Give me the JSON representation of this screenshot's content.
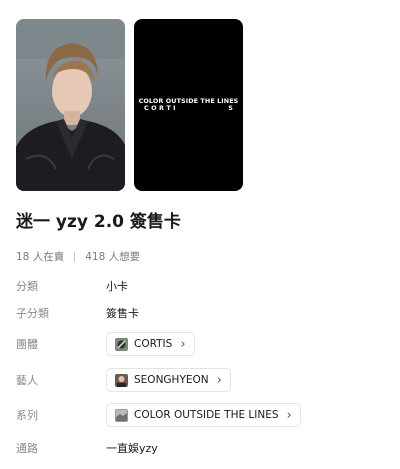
{
  "cards": {
    "back_line1": "COLOR OUTSIDE THE LINES",
    "back_line2_left": "C O R T I",
    "back_line2_right": "S"
  },
  "title": "迷一 yzy 2.0 簽售卡",
  "stats": {
    "selling": "18 人在賣",
    "wanting": "418 人想要"
  },
  "details": {
    "category_label": "分類",
    "category_value": "小卡",
    "subcategory_label": "子分類",
    "subcategory_value": "簽售卡",
    "group_label": "團體",
    "group_value": "CORTIS",
    "artist_label": "藝人",
    "artist_value": "SEONGHYEON",
    "series_label": "系列",
    "series_value": "COLOR OUTSIDE THE LINES",
    "channel_label": "通路",
    "channel_value": "一直娛yzy"
  },
  "icons": {
    "chevron": "chevron-right-icon"
  }
}
